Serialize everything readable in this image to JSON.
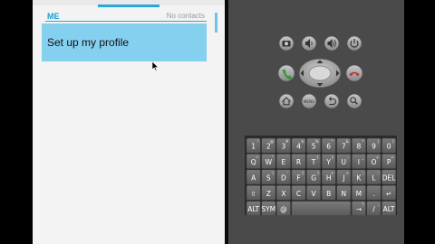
{
  "phone": {
    "section_label": "ME",
    "contacts_status": "No contacts",
    "profile_button_label": "Set up my profile"
  },
  "dpad_center_label": "",
  "menu_button_label": "MENU",
  "keyboard": {
    "rows": [
      [
        {
          "main": "1",
          "sub": "!"
        },
        {
          "main": "2",
          "sub": "@"
        },
        {
          "main": "3",
          "sub": "#"
        },
        {
          "main": "4",
          "sub": "$"
        },
        {
          "main": "5",
          "sub": "%"
        },
        {
          "main": "6",
          "sub": "^"
        },
        {
          "main": "7",
          "sub": "&"
        },
        {
          "main": "8",
          "sub": "*"
        },
        {
          "main": "9",
          "sub": "("
        },
        {
          "main": "0",
          "sub": ")"
        }
      ],
      [
        {
          "main": "Q",
          "sub": "~"
        },
        {
          "main": "W",
          "sub": "\""
        },
        {
          "main": "E",
          "sub": "´"
        },
        {
          "main": "R",
          "sub": ""
        },
        {
          "main": "T",
          "sub": "{"
        },
        {
          "main": "Y",
          "sub": "}"
        },
        {
          "main": "U",
          "sub": "-"
        },
        {
          "main": "I",
          "sub": "_"
        },
        {
          "main": "O",
          "sub": "+"
        },
        {
          "main": "P",
          "sub": "="
        }
      ],
      [
        {
          "main": "A",
          "sub": ""
        },
        {
          "main": "S",
          "sub": "\\"
        },
        {
          "main": "D",
          "sub": "'"
        },
        {
          "main": "F",
          "sub": "["
        },
        {
          "main": "G",
          "sub": "]"
        },
        {
          "main": "H",
          "sub": "<"
        },
        {
          "main": "J",
          "sub": ">"
        },
        {
          "main": "K",
          "sub": ";"
        },
        {
          "main": "L",
          "sub": ":"
        },
        {
          "main": "DEL",
          "sub": ""
        }
      ],
      [
        {
          "main": "⇧",
          "sub": ""
        },
        {
          "main": "Z",
          "sub": ""
        },
        {
          "main": "X",
          "sub": ""
        },
        {
          "main": "C",
          "sub": ""
        },
        {
          "main": "V",
          "sub": ""
        },
        {
          "main": "B",
          "sub": ""
        },
        {
          "main": "N",
          "sub": ""
        },
        {
          "main": "M",
          "sub": ""
        },
        {
          "main": ".",
          "sub": ""
        },
        {
          "main": "↵",
          "sub": ""
        }
      ],
      [
        {
          "main": "ALT",
          "sub": ""
        },
        {
          "main": "SYM",
          "sub": ""
        },
        {
          "main": "@",
          "sub": ""
        },
        {
          "main": "",
          "sub": ""
        },
        {
          "main": "→",
          "sub": "?"
        },
        {
          "main": "/",
          "sub": ","
        },
        {
          "main": "ALT",
          "sub": ""
        }
      ]
    ]
  }
}
